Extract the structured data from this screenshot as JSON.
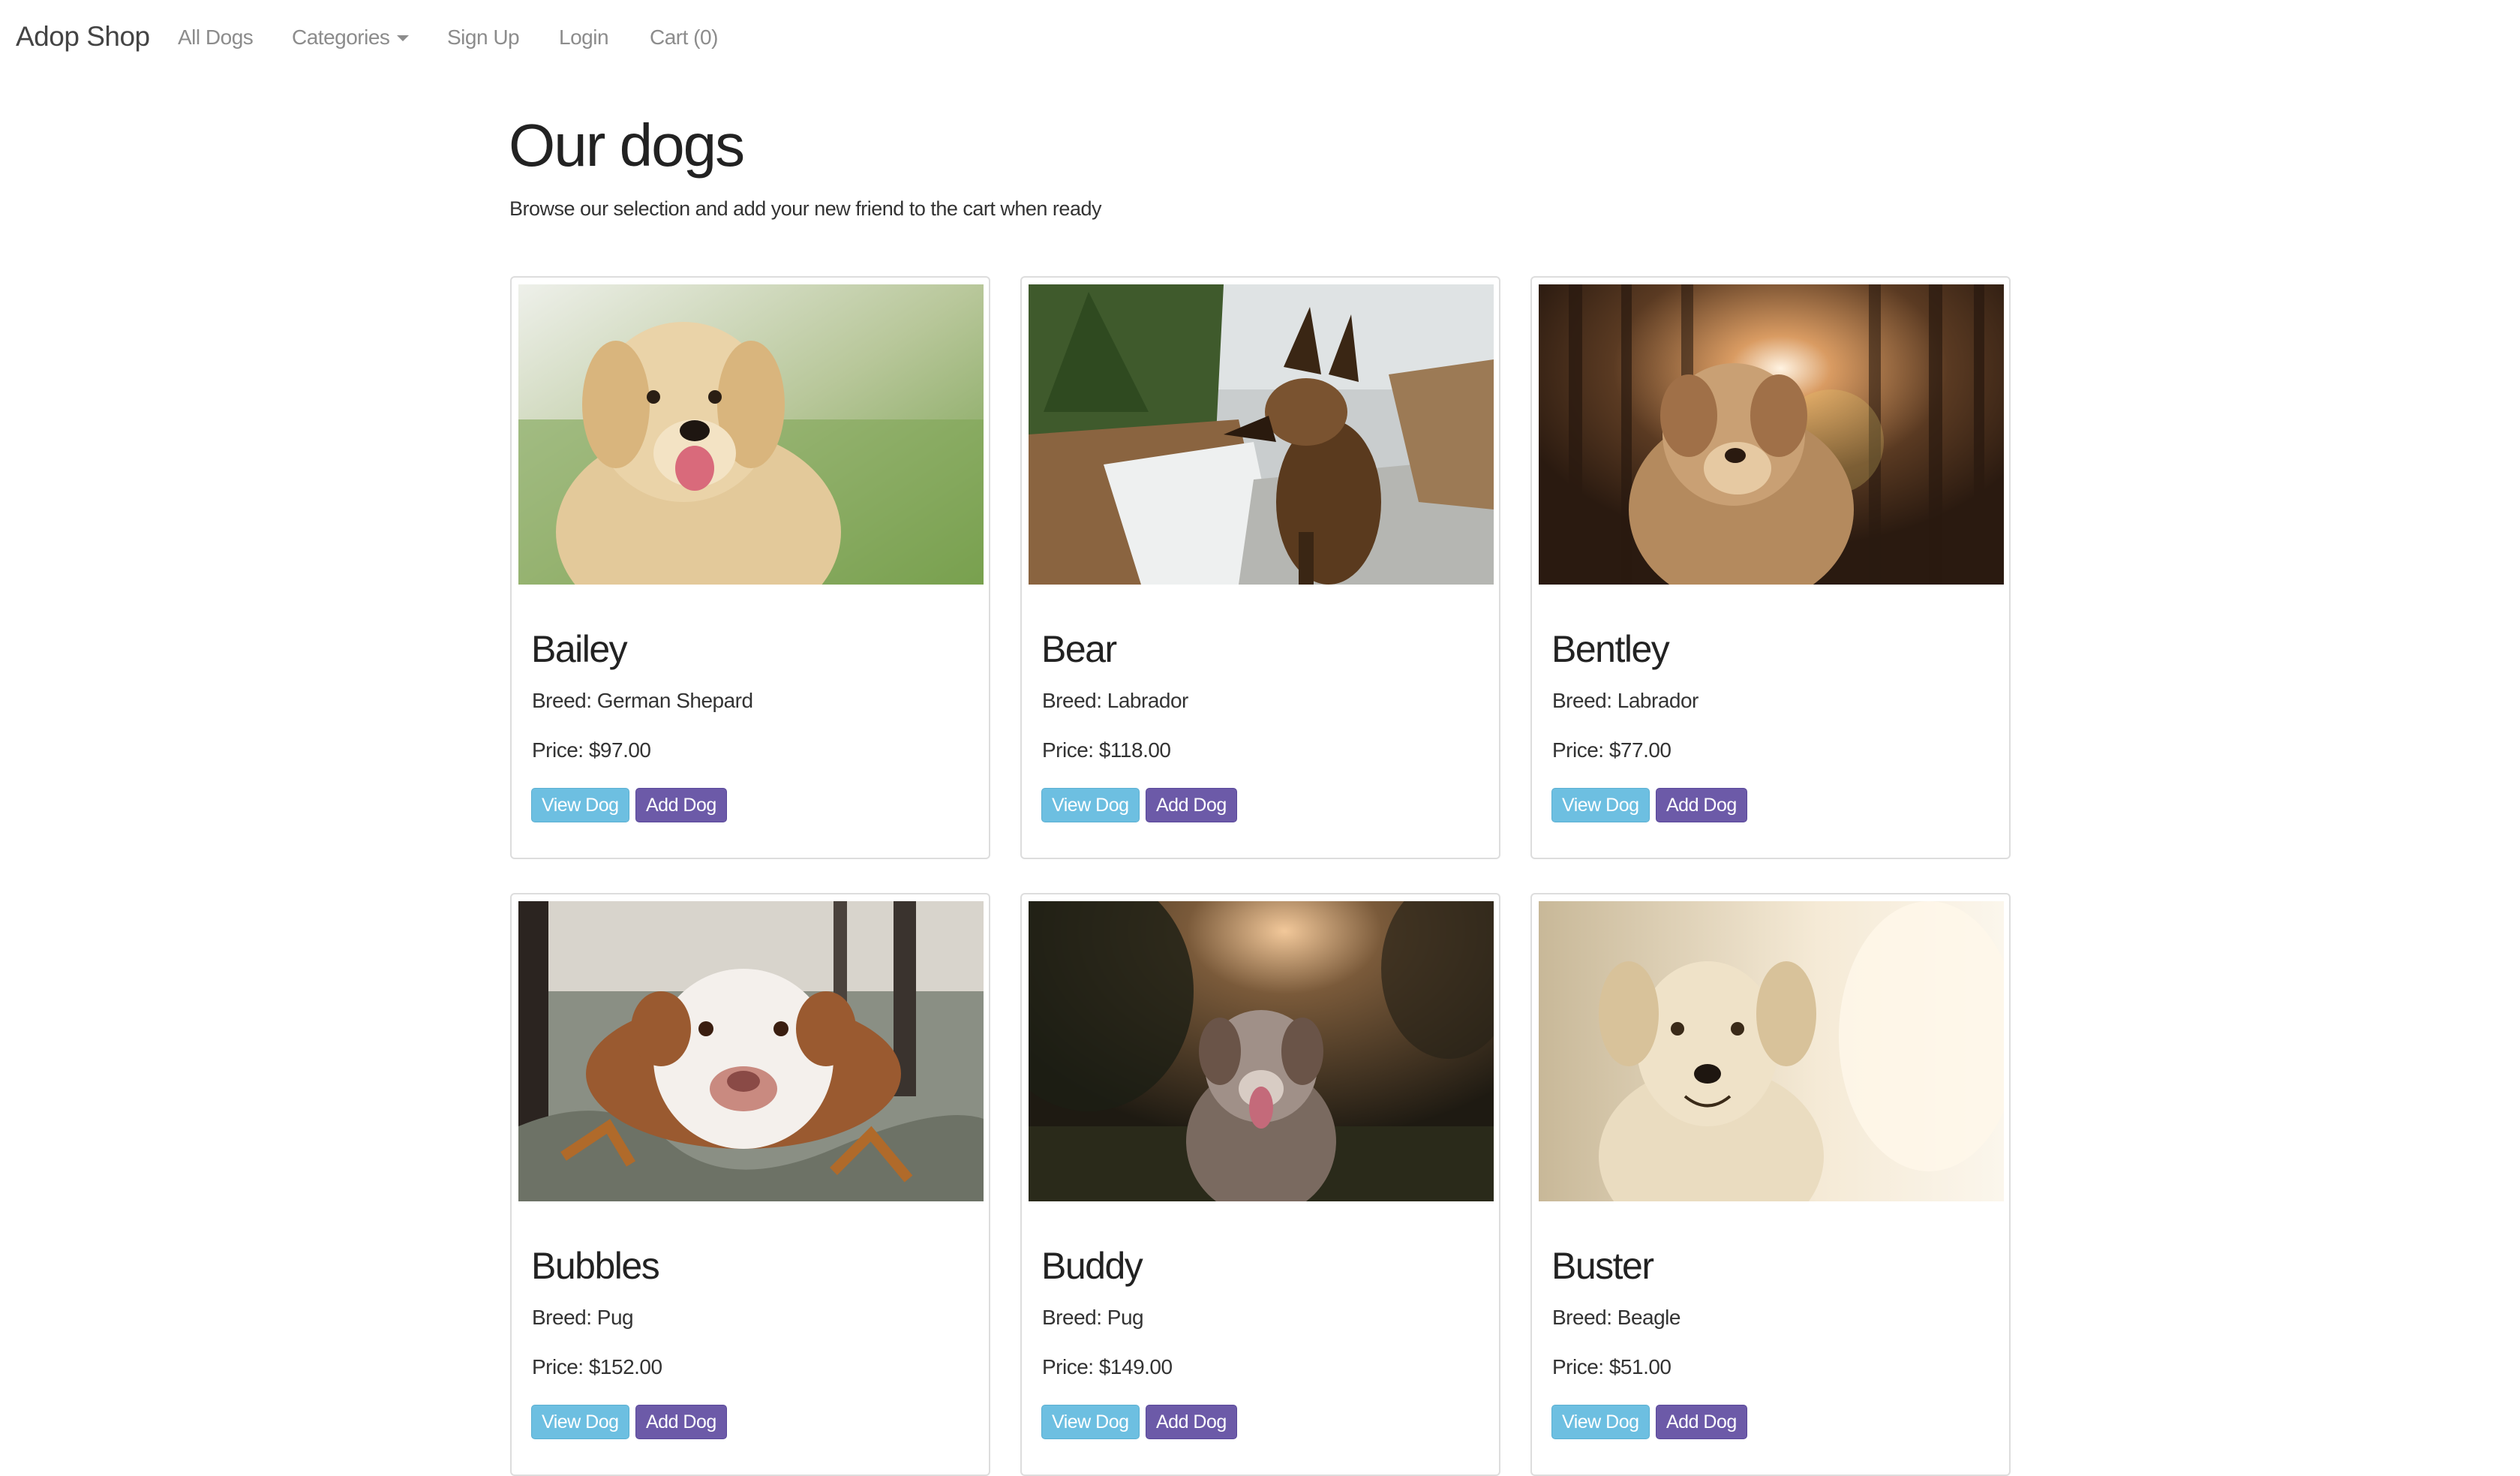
{
  "navbar": {
    "brand": "Adop Shop",
    "links": [
      {
        "label": "All Dogs"
      },
      {
        "label": "Categories"
      },
      {
        "label": "Sign Up"
      },
      {
        "label": "Login"
      },
      {
        "label": "Cart (0)"
      }
    ]
  },
  "header": {
    "title": "Our dogs",
    "subtitle": "Browse our selection and add your new friend to the cart when ready"
  },
  "labels": {
    "view_button": "View Dog",
    "add_button": "Add Dog"
  },
  "dogs": [
    {
      "name": "Bailey",
      "breed": "Breed: German Shepard",
      "price": "Price: $97.00"
    },
    {
      "name": "Bear",
      "breed": "Breed: Labrador",
      "price": "Price: $118.00"
    },
    {
      "name": "Bentley",
      "breed": "Breed: Labrador",
      "price": "Price: $77.00"
    },
    {
      "name": "Bubbles",
      "breed": "Breed: Pug",
      "price": "Price: $152.00"
    },
    {
      "name": "Buddy",
      "breed": "Breed: Pug",
      "price": "Price: $149.00"
    },
    {
      "name": "Buster",
      "breed": "Breed: Beagle",
      "price": "Price: $51.00"
    }
  ],
  "colors": {
    "view_button": "#6dbfe1",
    "add_button": "#6c5aa8",
    "card_border": "#dddddd",
    "nav_link": "#8c8c8c"
  }
}
